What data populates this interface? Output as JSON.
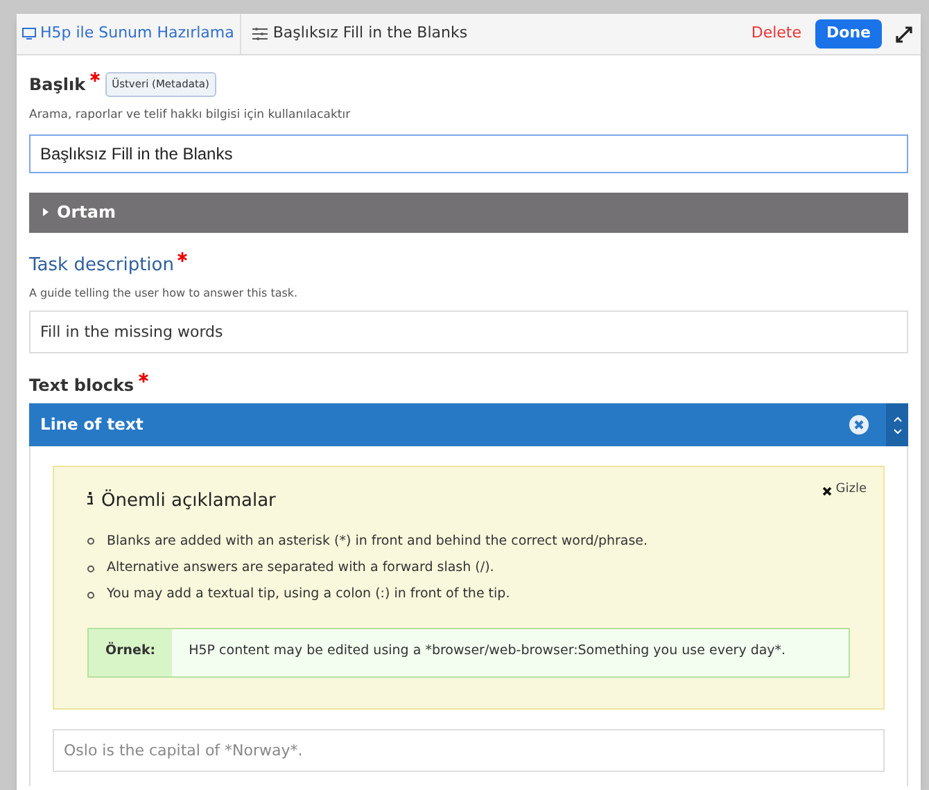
{
  "header": {
    "breadcrumb": "H5p ile Sunum Hazırlama",
    "title": "Başlıksız Fill in the Blanks",
    "delete": "Delete",
    "done": "Done"
  },
  "title_field": {
    "label": "Başlık",
    "required": true,
    "metadata": "Üstveri (Metadata)",
    "description": "Arama, raporlar ve telif hakkı bilgisi için kullanılacaktır",
    "value": "Başlıksız Fill in the Blanks"
  },
  "media": {
    "label": "Ortam",
    "expanded": false
  },
  "task_description": {
    "label": "Task description",
    "required": true,
    "description": "A guide telling the user how to answer this task.",
    "value": "Fill in the missing words"
  },
  "text_blocks": {
    "label": "Text blocks",
    "required": true,
    "item": {
      "title": "Line of text",
      "expanded": true,
      "notes": {
        "title": "Önemli açıklamalar",
        "hide": "Gizle",
        "items": [
          "Blanks are added with an asterisk (*) in front and behind the correct word/phrase.",
          "Alternative answers are separated with a forward slash (/).",
          "You may add a textual tip, using a colon (:) in front of the tip."
        ],
        "example_label": "Örnek:",
        "example": "H5P content may be edited using a *browser/web-browser:Something you use every day*."
      },
      "placeholder": "Oslo is the capital of *Norway*."
    }
  }
}
